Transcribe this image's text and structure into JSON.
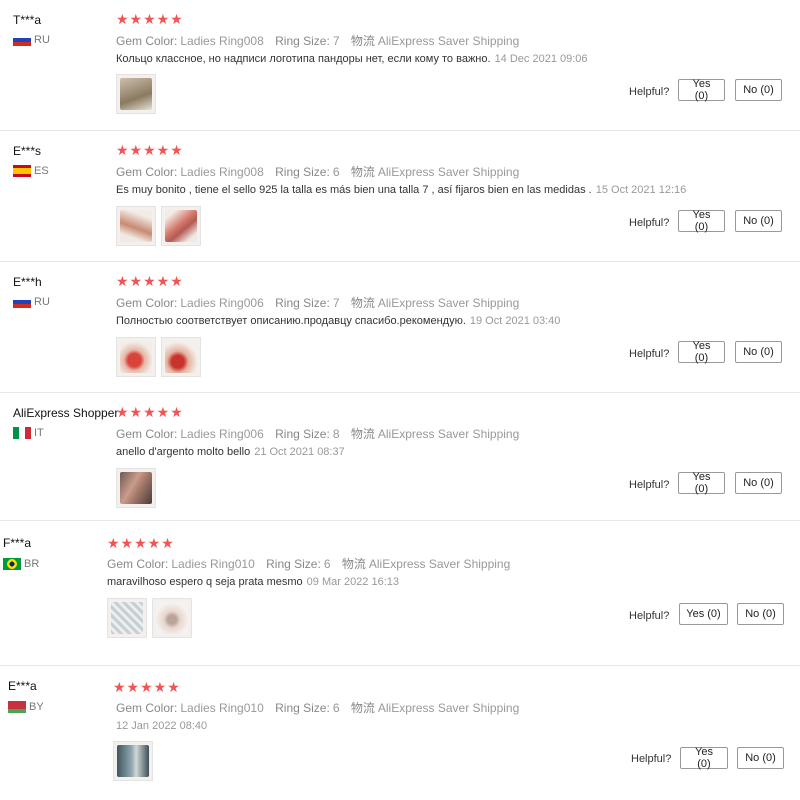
{
  "labels": {
    "gem_color": "Gem Color:",
    "ring_size": "Ring Size:",
    "shipping_label": "物流",
    "helpful": "Helpful?",
    "yes": "Yes (0)",
    "no": "No (0)"
  },
  "reviews": [
    {
      "user": "T***a",
      "country": "RU",
      "gem": "Ladies Ring008",
      "size": "7",
      "shipping": "AliExpress Saver Shipping",
      "comment": "Кольцо классное, но надписи логотипа пандоры нет, если кому то важно.",
      "date": "14 Dec 2021 09:06",
      "stars": "★★★★★"
    },
    {
      "user": "E***s",
      "country": "ES",
      "gem": "Ladies Ring008",
      "size": "6",
      "shipping": "AliExpress Saver Shipping",
      "comment": "Es muy bonito , tiene el sello 925 la talla es más bien una talla 7 , así fijaros bien en las medidas .",
      "date": "15 Oct 2021 12:16",
      "stars": "★★★★★"
    },
    {
      "user": "E***h",
      "country": "RU",
      "gem": "Ladies Ring006",
      "size": "7",
      "shipping": "AliExpress Saver Shipping",
      "comment": "Полностью соответствует описанию.продавцу спасибо.рекомендую.",
      "date": "19 Oct 2021 03:40",
      "stars": "★★★★★"
    },
    {
      "user": "AliExpress Shopper",
      "country": "IT",
      "gem": "Ladies Ring006",
      "size": "8",
      "shipping": "AliExpress Saver Shipping",
      "comment": "anello d'argento molto bello",
      "date": "21 Oct 2021 08:37",
      "stars": "★★★★★"
    },
    {
      "user": "F***a",
      "country": "BR",
      "gem": "Ladies Ring010",
      "size": "6",
      "shipping": "AliExpress Saver Shipping",
      "comment": "maravilhoso espero q seja prata mesmo",
      "date": "09 Mar 2022 16:13",
      "stars": "★★★★★"
    },
    {
      "user": "E***a",
      "country": "BY",
      "gem": "Ladies Ring010",
      "size": "6",
      "shipping": "AliExpress Saver Shipping",
      "comment": "",
      "date": "12 Jan 2022 08:40",
      "stars": "★★★★★"
    }
  ],
  "colors": {
    "star": "#f25454",
    "divider": "#e8e8e8"
  }
}
